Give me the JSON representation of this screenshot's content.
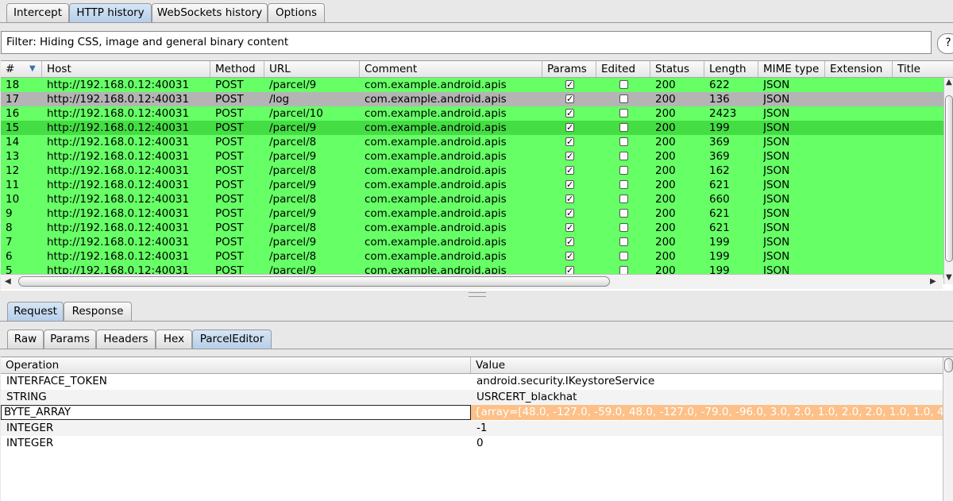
{
  "main_tabs": {
    "intercept": "Intercept",
    "http_history": "HTTP history",
    "websockets_history": "WebSockets history",
    "options": "Options"
  },
  "filter": {
    "text": "Filter:  Hiding CSS, image and general binary content",
    "help": "?"
  },
  "history": {
    "columns": {
      "num": "#",
      "host": "Host",
      "method": "Method",
      "url": "URL",
      "comment": "Comment",
      "params": "Params",
      "edited": "Edited",
      "status": "Status",
      "length": "Length",
      "mime": "MIME type",
      "extension": "Extension",
      "title": "Title"
    },
    "rows": [
      {
        "num": "18",
        "host": "http://192.168.0.12:40031",
        "method": "POST",
        "url": "/parcel/9",
        "comment": "com.example.android.apis",
        "params": true,
        "edited": false,
        "status": "200",
        "length": "622",
        "mime": "JSON"
      },
      {
        "num": "17",
        "host": "http://192.168.0.12:40031",
        "method": "POST",
        "url": "/log",
        "comment": "com.example.android.apis",
        "params": true,
        "edited": false,
        "status": "200",
        "length": "136",
        "mime": "JSON"
      },
      {
        "num": "16",
        "host": "http://192.168.0.12:40031",
        "method": "POST",
        "url": "/parcel/10",
        "comment": "com.example.android.apis",
        "params": true,
        "edited": false,
        "status": "200",
        "length": "2423",
        "mime": "JSON"
      },
      {
        "num": "15",
        "host": "http://192.168.0.12:40031",
        "method": "POST",
        "url": "/parcel/9",
        "comment": "com.example.android.apis",
        "params": true,
        "edited": false,
        "status": "200",
        "length": "199",
        "mime": "JSON"
      },
      {
        "num": "14",
        "host": "http://192.168.0.12:40031",
        "method": "POST",
        "url": "/parcel/8",
        "comment": "com.example.android.apis",
        "params": true,
        "edited": false,
        "status": "200",
        "length": "369",
        "mime": "JSON"
      },
      {
        "num": "13",
        "host": "http://192.168.0.12:40031",
        "method": "POST",
        "url": "/parcel/9",
        "comment": "com.example.android.apis",
        "params": true,
        "edited": false,
        "status": "200",
        "length": "369",
        "mime": "JSON"
      },
      {
        "num": "12",
        "host": "http://192.168.0.12:40031",
        "method": "POST",
        "url": "/parcel/8",
        "comment": "com.example.android.apis",
        "params": true,
        "edited": false,
        "status": "200",
        "length": "162",
        "mime": "JSON"
      },
      {
        "num": "11",
        "host": "http://192.168.0.12:40031",
        "method": "POST",
        "url": "/parcel/9",
        "comment": "com.example.android.apis",
        "params": true,
        "edited": false,
        "status": "200",
        "length": "621",
        "mime": "JSON"
      },
      {
        "num": "10",
        "host": "http://192.168.0.12:40031",
        "method": "POST",
        "url": "/parcel/8",
        "comment": "com.example.android.apis",
        "params": true,
        "edited": false,
        "status": "200",
        "length": "660",
        "mime": "JSON"
      },
      {
        "num": "9",
        "host": "http://192.168.0.12:40031",
        "method": "POST",
        "url": "/parcel/9",
        "comment": "com.example.android.apis",
        "params": true,
        "edited": false,
        "status": "200",
        "length": "621",
        "mime": "JSON"
      },
      {
        "num": "8",
        "host": "http://192.168.0.12:40031",
        "method": "POST",
        "url": "/parcel/8",
        "comment": "com.example.android.apis",
        "params": true,
        "edited": false,
        "status": "200",
        "length": "621",
        "mime": "JSON"
      },
      {
        "num": "7",
        "host": "http://192.168.0.12:40031",
        "method": "POST",
        "url": "/parcel/9",
        "comment": "com.example.android.apis",
        "params": true,
        "edited": false,
        "status": "200",
        "length": "199",
        "mime": "JSON"
      },
      {
        "num": "6",
        "host": "http://192.168.0.12:40031",
        "method": "POST",
        "url": "/parcel/8",
        "comment": "com.example.android.apis",
        "params": true,
        "edited": false,
        "status": "200",
        "length": "199",
        "mime": "JSON"
      },
      {
        "num": "5",
        "host": "http://192.168.0.12:40031",
        "method": "POST",
        "url": "/parcel/9",
        "comment": "com.example.android.apis",
        "params": true,
        "edited": false,
        "status": "200",
        "length": "199",
        "mime": "JSON"
      }
    ],
    "selected_index": 1,
    "highlighted_index": 3,
    "colors": {
      "green": "#66ff66",
      "green_dark": "#44dd44",
      "selected": "#b4b4b4"
    }
  },
  "message_tabs": {
    "request": "Request",
    "response": "Response"
  },
  "editor_tabs": {
    "raw": "Raw",
    "params": "Params",
    "headers": "Headers",
    "hex": "Hex",
    "parcel_editor": "ParcelEditor"
  },
  "operations": {
    "columns": {
      "operation": "Operation",
      "value": "Value"
    },
    "rows": [
      {
        "operation": "INTERFACE_TOKEN",
        "value": "android.security.IKeystoreService"
      },
      {
        "operation": "STRING",
        "value": "USRCERT_blackhat"
      },
      {
        "operation": "BYTE_ARRAY",
        "value": "{array=[48.0, -127.0, -59.0, 48.0, -127.0, -79.0, -96.0, 3.0, 2.0, 1.0, 2.0, 2.0, 1.0, 1.0, 4..."
      },
      {
        "operation": "INTEGER",
        "value": "-1"
      },
      {
        "operation": "INTEGER",
        "value": "0"
      }
    ],
    "editing_index": 2,
    "editing_color": "#fcc088"
  }
}
